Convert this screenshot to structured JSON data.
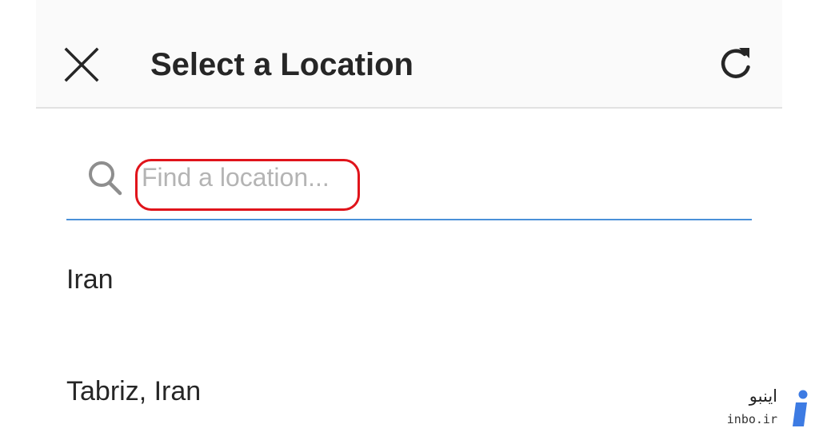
{
  "header": {
    "title": "Select a Location",
    "close_icon": "close-icon",
    "refresh_icon": "refresh-icon",
    "background": "#fafafa"
  },
  "search": {
    "icon": "search-icon",
    "placeholder": "Find a location...",
    "value": "",
    "underline_color": "#4a90d9",
    "highlight_color": "#e0141b"
  },
  "locations": [
    {
      "label": "Iran"
    },
    {
      "label": "Tabriz, Iran"
    }
  ],
  "watermark": {
    "text_fa": "اینبو",
    "text_en": "inbo.ir",
    "logo_icon": "inbo-logo-icon",
    "logo_color": "#3d7be3"
  }
}
